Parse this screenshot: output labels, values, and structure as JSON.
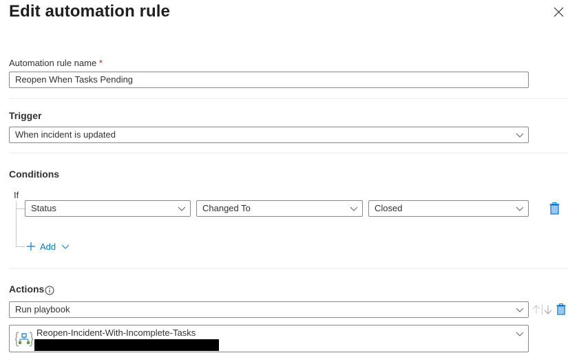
{
  "panel": {
    "title": "Edit automation rule",
    "close_icon": "close-icon"
  },
  "rule_name": {
    "label": "Automation rule name",
    "required_marker": "*",
    "value": "Reopen When Tasks Pending"
  },
  "trigger": {
    "heading": "Trigger",
    "selected": "When incident is updated"
  },
  "conditions": {
    "heading": "Conditions",
    "if_label": "If",
    "rows": [
      {
        "property": "Status",
        "operator": "Changed To",
        "value": "Closed"
      }
    ],
    "add_label": "Add"
  },
  "actions": {
    "heading": "Actions",
    "info_icon": "info-icon",
    "rows": [
      {
        "action": "Run playbook",
        "playbook": "Reopen-Incident-With-Incomplete-Tasks"
      }
    ]
  },
  "colors": {
    "accent": "#0078d4",
    "required": "#a4262c",
    "border": "#8a8886",
    "divider": "#edebe9"
  }
}
